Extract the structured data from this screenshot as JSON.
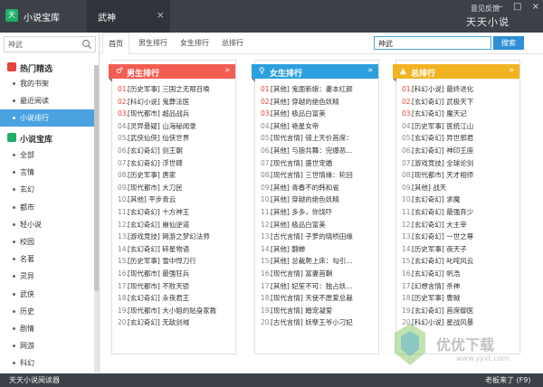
{
  "app": {
    "title": "小说宝库",
    "logo_text": "天",
    "active_tab": "武神",
    "tab_close": "×",
    "feedback": "意见反馈",
    "window_controls": [
      "—",
      "□",
      "×"
    ],
    "brand": "天天小说"
  },
  "sidebar": {
    "search_value": "神武",
    "sections": [
      {
        "label": "热门精选",
        "icon_color": "#e5433b",
        "items": [
          {
            "label": "我的书架"
          },
          {
            "label": "最近阅读"
          },
          {
            "label": "小说排行",
            "active": true
          }
        ]
      },
      {
        "label": "小说宝库",
        "icon_color": "#1fae6a",
        "items": [
          {
            "label": "全部"
          },
          {
            "label": "言情"
          },
          {
            "label": "玄幻"
          },
          {
            "label": "都市"
          },
          {
            "label": "轻小说"
          },
          {
            "label": "校园"
          },
          {
            "label": "名著"
          },
          {
            "label": "灵异"
          },
          {
            "label": "武侠"
          },
          {
            "label": "历史"
          },
          {
            "label": "剧情"
          },
          {
            "label": "网游"
          },
          {
            "label": "科幻"
          }
        ]
      }
    ]
  },
  "main": {
    "subtabs": [
      "首页",
      "男生排行",
      "女生排行",
      "总排行"
    ],
    "active_subtab": 0,
    "search_value": "神武",
    "search_button": "搜索",
    "more_icon": "»",
    "panels": [
      {
        "title": "男生排行",
        "icon": "♂",
        "color": "#f25d52",
        "entries": [
          "[历史军事] 三国之无限召唤",
          "[科幻小说] 鬼葬法医",
          "[现代都市] 超品战兵",
          "[灵异悬疑] 山海秘闻录",
          "[武侠仙侠] 仙侠世界",
          "[玄幻奇幻] 剑王朝",
          "[玄幻奇幻] 浮世碑",
          "[历史军事] 唐家",
          "[现代都市] 大刀民",
          "[其他] 平步青云",
          "[玄幻奇幻] 十方神王",
          "[玄幻奇幻] 崩仙逆道",
          "[游戏竞技] 网游之梦幻法师",
          "[玄幻奇幻] 碎星物语",
          "[历史军事] 雪中悍刀行",
          "[现代都市] 最强狂兵",
          "[现代都市] 不败天骄",
          "[玄幻奇幻] 永夜君王",
          "[现代都市] 大小姐的贴身家教",
          "[玄幻奇幻] 无敌剑域"
        ]
      },
      {
        "title": "女生排行",
        "icon": "♀",
        "color": "#2ea0e0",
        "entries": [
          "[其他] 鬼面新娘：妻本红颜",
          "[其他] 穿越的绝色妖精",
          "[其他] 极品白富美",
          "[其他] 艳星女帝",
          "[现代言情] 错上天价首席：",
          "[其他] 与狼共舞：完爆恶...",
          "[现代言情] 盛世宠婚",
          "[现代言情] 三世情缘：轮回",
          "[其他] 青春不的韩和省",
          "[其他] 穿越的绝色妖精",
          "[其他] 多多，你饶吓",
          "[其他] 极品白富美",
          "[古代言情] 子萝的晓桥田缘",
          "[其他] 翻蝉",
          "[其他] 总裁爬上床：勾引...",
          "[现代言情] 富妻首鞘",
          "[其他] 妃笙不可：独占妖...",
          "[现代言情] 天使不愿爱总裁",
          "[现代言情] 婚宠凝爱",
          "[古代言情] 妖孽王爷小刁妃"
        ]
      },
      {
        "title": "总排行",
        "icon": "▲",
        "color": "#f2b323",
        "entries": [
          "[科幻小说] 最终进化",
          "[玄幻奇幻] 武极天下",
          "[玄幻奇幻] 魔天记",
          "[历史军事] 医统江山",
          "[玄幻奇幻] 异世邪君",
          "[玄幻奇幻] 神印王座",
          "[游戏竞技] 全球论剑",
          "[现代都市] 天才相师",
          "[其他] 战天",
          "[玄幻奇幻] 求魔",
          "[玄幻奇幻] 最强弃少",
          "[玄幻奇幻] 大主宰",
          "[玄幻奇幻] 一世之尊",
          "[历史军事] 夜天子",
          "[玄幻奇幻] 叱咤风云",
          "[玄幻奇幻] 帆浩",
          "[幻想言情] 杀神",
          "[历史军事] 曹贼",
          "[玄幻奇幻] 首席御医",
          "[科幻小说] 星战风暴"
        ]
      }
    ]
  },
  "status": {
    "text": "天天小说阅读器",
    "boss_key": "老板来了 (F9)"
  },
  "watermark": {
    "text": "优优下载",
    "sub": "www.yyxt.com"
  }
}
